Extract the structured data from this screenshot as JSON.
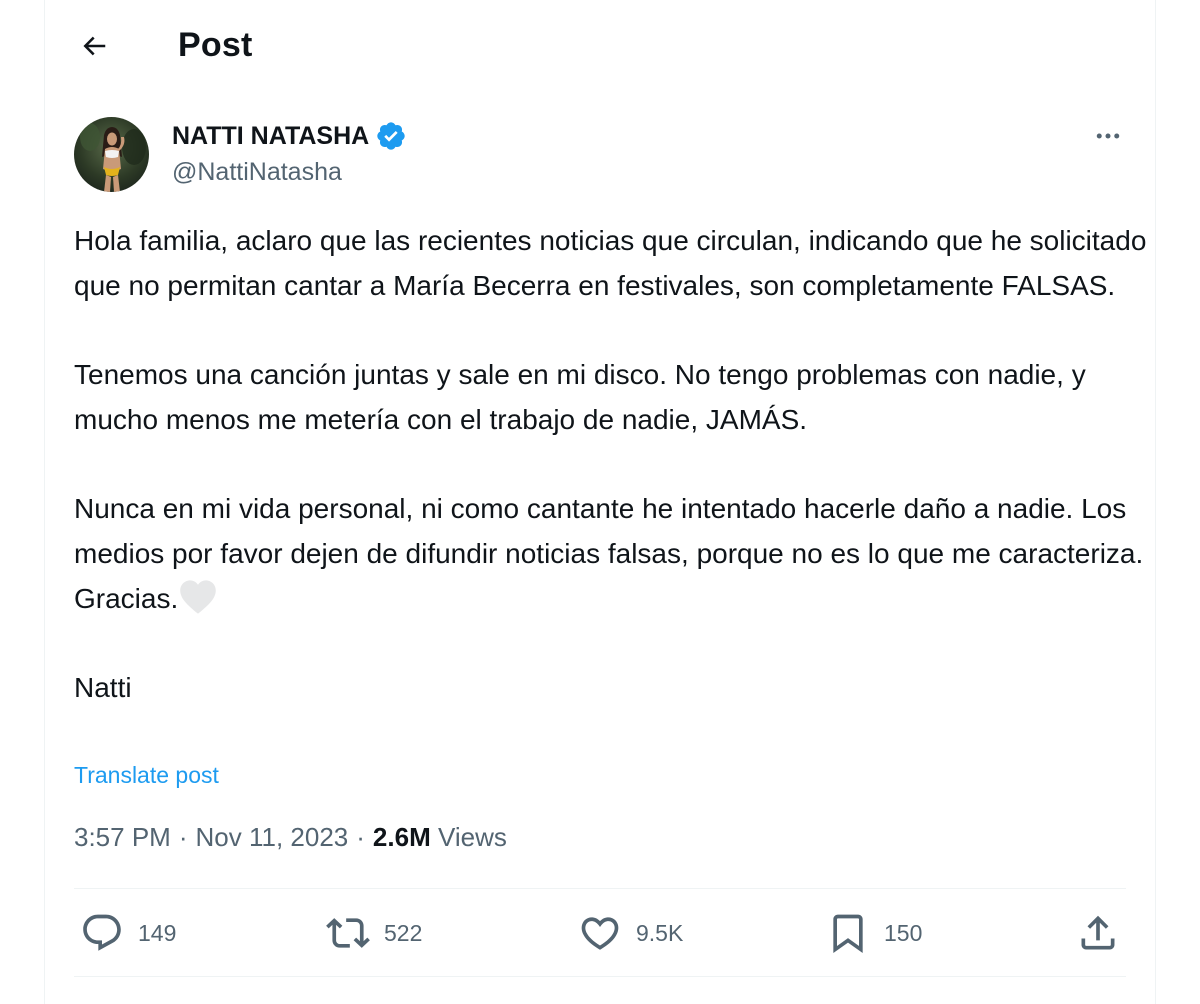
{
  "header": {
    "title": "Post"
  },
  "author": {
    "name": "NATTI NATASHA",
    "handle": "@NattiNatasha",
    "verified": true,
    "verified_color": "#1d9bf0"
  },
  "post": {
    "paragraphs": [
      "Hola familia, aclaro que las recientes noticias que circulan, indicando que he solicitado que no permitan cantar a María Becerra en festivales, son completamente FALSAS.",
      "Tenemos una canción juntas y sale en mi disco. No tengo problemas con nadie, y mucho menos me metería con el trabajo de nadie, JAMÁS.",
      "Nunca en mi vida personal, ni como cantante he intentado hacerle daño a nadie. Los medios por favor dejen de difundir noticias falsas, porque no es lo que me caracteriza. Gracias.",
      "Natti"
    ],
    "emoji": "white-heart-icon",
    "translate_label": "Translate post"
  },
  "meta": {
    "time": "3:57 PM",
    "separator": "·",
    "date": "Nov 11, 2023",
    "views_count": "2.6M",
    "views_label": "Views"
  },
  "actions": {
    "replies": "149",
    "reposts": "522",
    "likes": "9.5K",
    "bookmarks": "150"
  },
  "colors": {
    "accent": "#1d9bf0",
    "secondary_text": "#536471",
    "primary_text": "#0f1419",
    "border": "#eff3f4"
  }
}
